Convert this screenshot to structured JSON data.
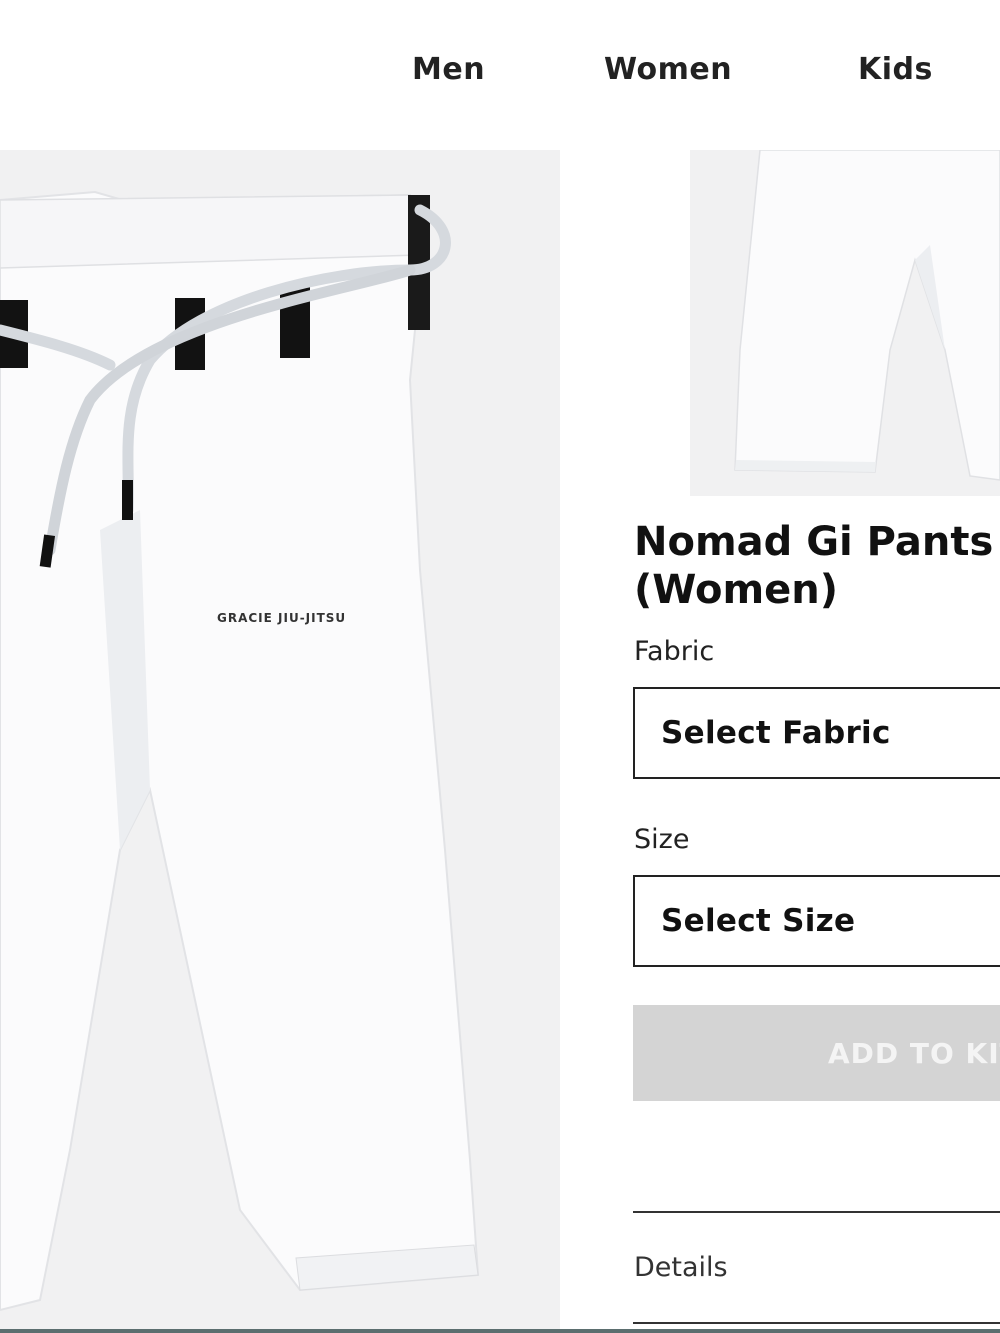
{
  "nav": {
    "items": [
      {
        "label": "Men"
      },
      {
        "label": "Women"
      },
      {
        "label": "Kids"
      }
    ]
  },
  "product": {
    "title_line1": "Nomad Gi Pants",
    "title_line2": "(Women)",
    "main_image_logo": "GRACIE JIU-JITSU"
  },
  "options": {
    "fabric_label": "Fabric",
    "fabric_value": "Select Fabric",
    "size_label": "Size",
    "size_value": "Select Size"
  },
  "actions": {
    "add_to_kit": "ADD TO KIT"
  },
  "sections": {
    "details": "Details"
  },
  "colors": {
    "accent_disabled": "#d4d4d4",
    "image_bg": "#f1f1f2"
  }
}
